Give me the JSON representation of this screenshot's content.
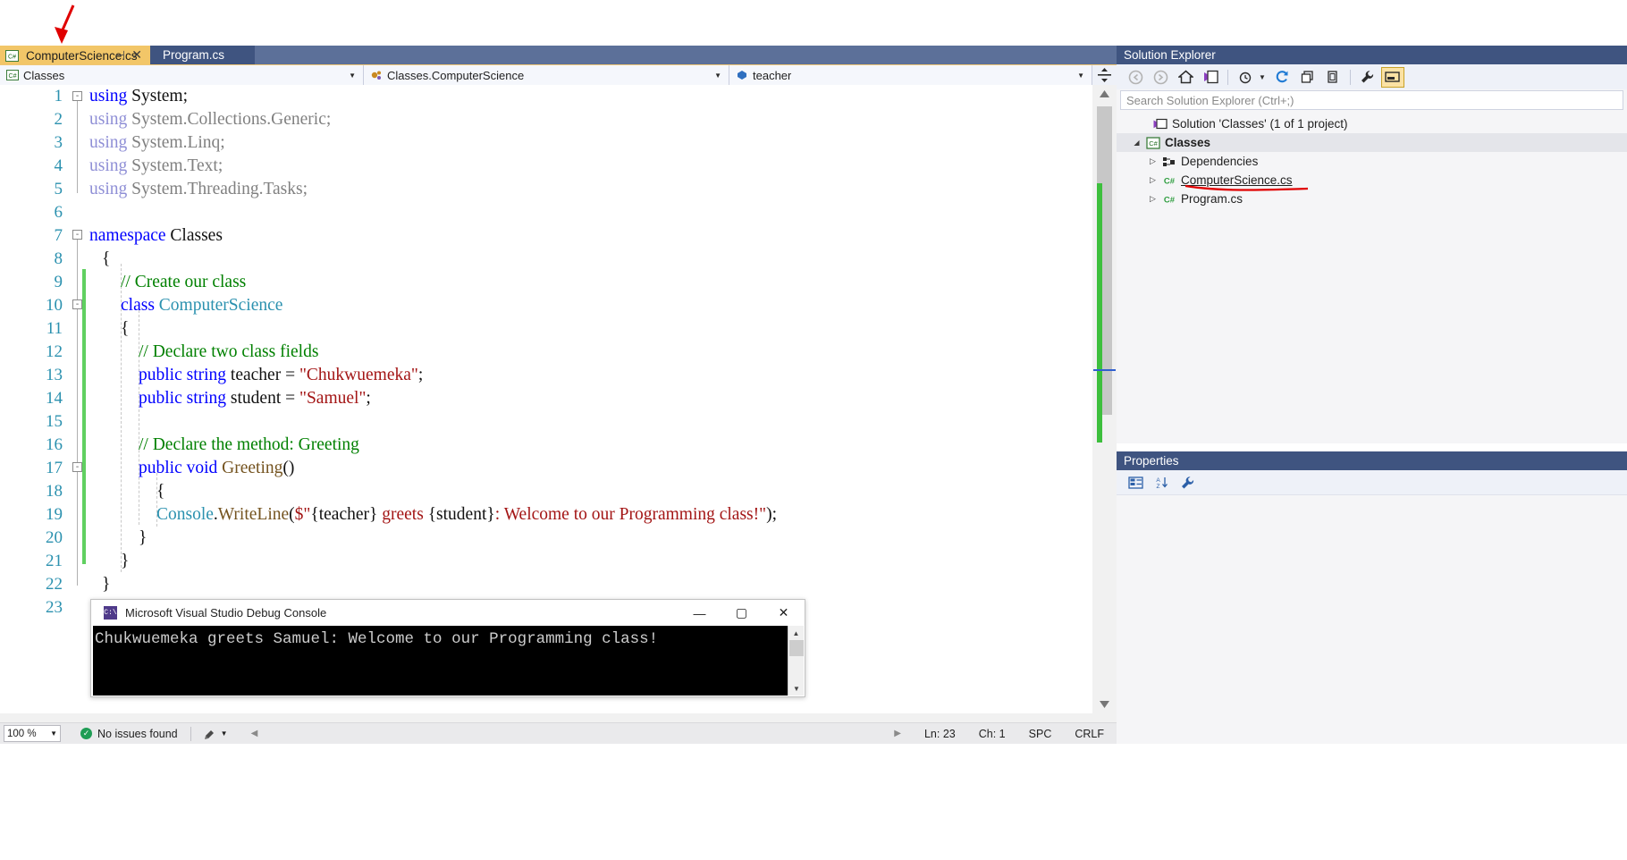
{
  "tabs": {
    "active": {
      "label": "ComputerScience.cs",
      "icon": "csharp-file-icon",
      "pin": "pin-icon",
      "close": "close-icon"
    },
    "inactive": [
      {
        "label": "Program.cs"
      }
    ],
    "overflow_caret": "chevron-down-icon",
    "gear": "gear-icon"
  },
  "navbar": {
    "project": {
      "icon": "csharp-project-icon",
      "value": "Classes"
    },
    "type": {
      "icon": "class-icon",
      "value": "Classes.ComputerScience"
    },
    "member": {
      "icon": "field-icon",
      "value": "teacher"
    },
    "split_icon": "split-editor-icon"
  },
  "editor": {
    "line_numbers": [
      "1",
      "2",
      "3",
      "4",
      "5",
      "6",
      "7",
      "8",
      "9",
      "10",
      "11",
      "12",
      "13",
      "14",
      "15",
      "16",
      "17",
      "18",
      "19",
      "20",
      "21",
      "22",
      "23"
    ],
    "lines": [
      {
        "n": 1,
        "text": "using System;"
      },
      {
        "n": 2,
        "text": "using System.Collections.Generic;"
      },
      {
        "n": 3,
        "text": "using System.Linq;"
      },
      {
        "n": 4,
        "text": "using System.Text;"
      },
      {
        "n": 5,
        "text": "using System.Threading.Tasks;"
      },
      {
        "n": 6,
        "text": ""
      },
      {
        "n": 7,
        "text": "namespace Classes"
      },
      {
        "n": 8,
        "text": "{"
      },
      {
        "n": 9,
        "text": "    // Create our class"
      },
      {
        "n": 10,
        "text": "    class ComputerScience"
      },
      {
        "n": 11,
        "text": "    {"
      },
      {
        "n": 12,
        "text": "        // Declare two class fields"
      },
      {
        "n": 13,
        "text": "        public string teacher = \"Chukwuemeka\";"
      },
      {
        "n": 14,
        "text": "        public string student = \"Samuel\";"
      },
      {
        "n": 15,
        "text": ""
      },
      {
        "n": 16,
        "text": "        // Declare the method: Greeting"
      },
      {
        "n": 17,
        "text": "        public void Greeting()"
      },
      {
        "n": 18,
        "text": "        {"
      },
      {
        "n": 19,
        "text": "            Console.WriteLine($\"{teacher} greets {student}: Welcome to our Programming class!\");"
      },
      {
        "n": 20,
        "text": "        }"
      },
      {
        "n": 21,
        "text": "    }"
      },
      {
        "n": 22,
        "text": "}"
      },
      {
        "n": 23,
        "text": ""
      }
    ],
    "tokens": {
      "using": "using",
      "semi": ";",
      "system": "System",
      "sys_collections": "System.Collections.Generic",
      "sys_linq": "System.Linq",
      "sys_text": "System.Text",
      "sys_threading": "System.Threading.Tasks",
      "namespace": "namespace",
      "ns_name": "Classes",
      "brace_open": "{",
      "brace_close": "}",
      "comment_create": "// Create our class",
      "class_kw": "class",
      "class_name": "ComputerScience",
      "comment_fields": "// Declare two class fields",
      "public": "public",
      "string": "string",
      "void": "void",
      "teacher_ident": " teacher = ",
      "teacher_value": "\"Chukwuemeka\"",
      "student_ident": " student = ",
      "student_value": "\"Samuel\"",
      "comment_method": "// Declare the method: Greeting",
      "greeting_name": "Greeting",
      "parens": "()",
      "console": "Console",
      "dot": ".",
      "writeline": "WriteLine",
      "open_paren": "(",
      "dollar_quote": "$\"",
      "interp_teacher": "{teacher}",
      "greets": " greets ",
      "interp_student": "{student}",
      "msg_tail": ": Welcome to our Programming class!",
      "close_quote": "\"",
      "close_paren_semi": ");"
    },
    "fold_markers": [
      "-",
      "-",
      "-",
      "-"
    ]
  },
  "console_window": {
    "title": "Microsoft Visual Studio Debug Console",
    "icon": "console-icon",
    "minimize": "minimize-icon",
    "maximize": "maximize-icon",
    "close": "close-icon",
    "output": "Chukwuemeka greets Samuel: Welcome to our Programming class!"
  },
  "solution_explorer": {
    "title": "Solution Explorer",
    "toolbar": [
      {
        "name": "back-icon",
        "label": ""
      },
      {
        "name": "forward-icon",
        "label": ""
      },
      {
        "name": "home-icon",
        "label": ""
      },
      {
        "name": "pending-changes-icon",
        "label": ""
      },
      {
        "name": "history-icon",
        "label": ""
      },
      {
        "name": "refresh-icon",
        "label": ""
      },
      {
        "name": "collapse-all-icon",
        "label": ""
      },
      {
        "name": "show-all-files-icon",
        "label": ""
      },
      {
        "name": "properties-wrench-icon",
        "label": ""
      },
      {
        "name": "preview-selected-items-icon",
        "label": ""
      }
    ],
    "search_placeholder": "Search Solution Explorer (Ctrl+;)",
    "tree": [
      {
        "label": "Solution 'Classes' (1 of 1 project)",
        "icon": "solution-icon",
        "indent": 0,
        "twisty": "",
        "bold": false,
        "selected": false
      },
      {
        "label": "Classes",
        "icon": "csharp-project-icon",
        "indent": 1,
        "twisty": "▲",
        "bold": true,
        "selected": true
      },
      {
        "label": "Dependencies",
        "icon": "dependencies-icon",
        "indent": 2,
        "twisty": "▶",
        "bold": false,
        "selected": false
      },
      {
        "label": "ComputerScience.cs",
        "icon": "csharp-file-icon",
        "indent": 2,
        "twisty": "▶",
        "bold": false,
        "selected": false,
        "annotated": true
      },
      {
        "label": "Program.cs",
        "icon": "csharp-file-icon",
        "indent": 2,
        "twisty": "▶",
        "bold": false,
        "selected": false
      }
    ]
  },
  "properties_panel": {
    "title": "Properties",
    "toolbar": [
      {
        "name": "categorized-icon"
      },
      {
        "name": "alphabetical-icon"
      },
      {
        "name": "property-pages-wrench-icon"
      }
    ]
  },
  "status_bar": {
    "zoom": "100 %",
    "zoom_caret": "chevron-down-icon",
    "issues": "No issues found",
    "feedback_icon": "feedback-icon",
    "feedback_caret": "chevron-down-icon",
    "line": "Ln: 23",
    "col": "Ch: 1",
    "spaces": "SPC",
    "eol": "CRLF"
  },
  "colors": {
    "accent_tab_active": "#f2c668",
    "panel_header": "#3f5480",
    "tab_strip": "#5c7099",
    "keyword": "#0000ff",
    "type": "#2b91af",
    "comment": "#008000",
    "string": "#a31515",
    "method": "#74531f",
    "line_number": "#2b91af",
    "annotation_red": "#e00000",
    "change_bar_green": "#60d060"
  }
}
